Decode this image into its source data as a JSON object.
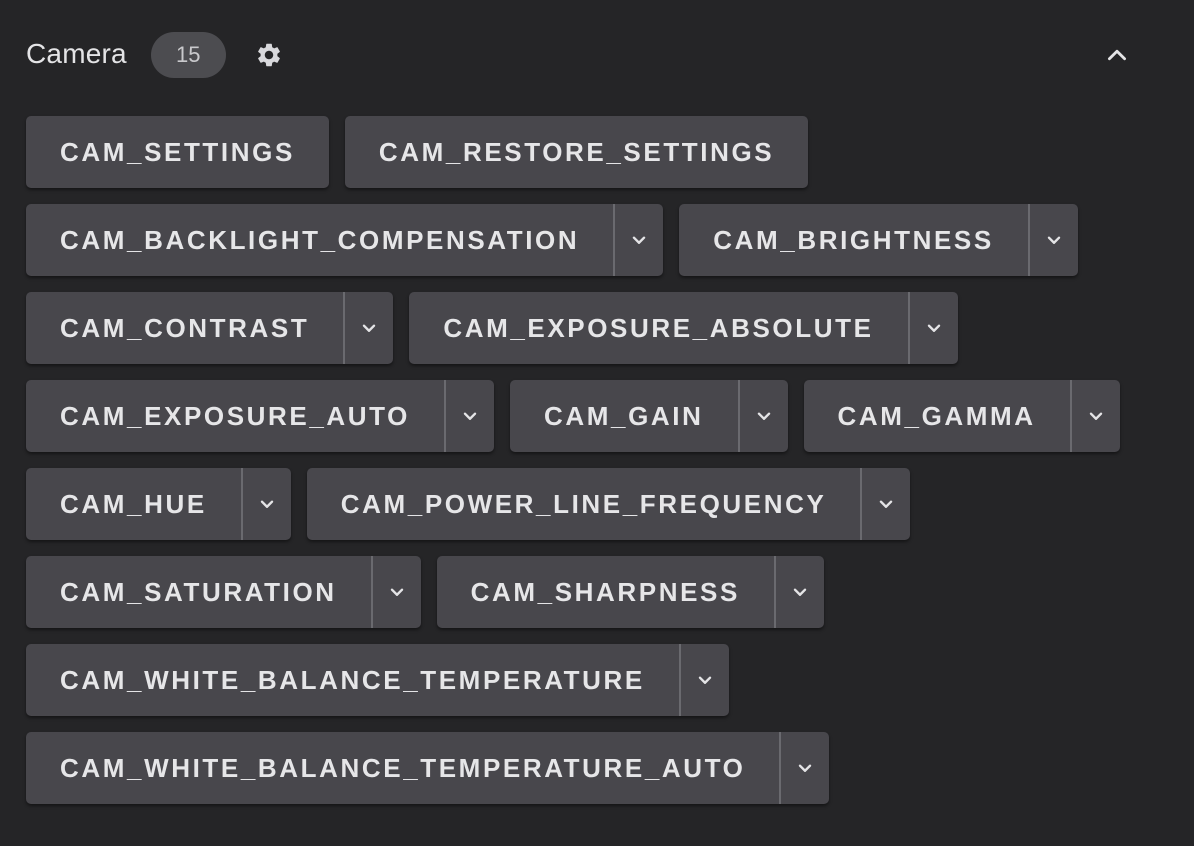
{
  "header": {
    "title": "Camera",
    "count": "15"
  },
  "icons": {
    "settings": "gear-icon",
    "collapse": "chevron-up-icon",
    "dropdown": "chevron-down-icon"
  },
  "colors": {
    "background": "#252527",
    "button": "#48474c",
    "badge": "#4c4c50",
    "text": "#e6e6e8"
  },
  "rows": [
    [
      {
        "label": "CAM_SETTINGS",
        "dropdown": false
      },
      {
        "label": "CAM_RESTORE_SETTINGS",
        "dropdown": false
      }
    ],
    [
      {
        "label": "CAM_BACKLIGHT_COMPENSATION",
        "dropdown": true
      },
      {
        "label": "CAM_BRIGHTNESS",
        "dropdown": true
      }
    ],
    [
      {
        "label": "CAM_CONTRAST",
        "dropdown": true
      },
      {
        "label": "CAM_EXPOSURE_ABSOLUTE",
        "dropdown": true
      }
    ],
    [
      {
        "label": "CAM_EXPOSURE_AUTO",
        "dropdown": true
      },
      {
        "label": "CAM_GAIN",
        "dropdown": true
      },
      {
        "label": "CAM_GAMMA",
        "dropdown": true
      }
    ],
    [
      {
        "label": "CAM_HUE",
        "dropdown": true
      },
      {
        "label": "CAM_POWER_LINE_FREQUENCY",
        "dropdown": true
      }
    ],
    [
      {
        "label": "CAM_SATURATION",
        "dropdown": true
      },
      {
        "label": "CAM_SHARPNESS",
        "dropdown": true
      }
    ],
    [
      {
        "label": "CAM_WHITE_BALANCE_TEMPERATURE",
        "dropdown": true
      }
    ],
    [
      {
        "label": "CAM_WHITE_BALANCE_TEMPERATURE_AUTO",
        "dropdown": true
      }
    ]
  ]
}
